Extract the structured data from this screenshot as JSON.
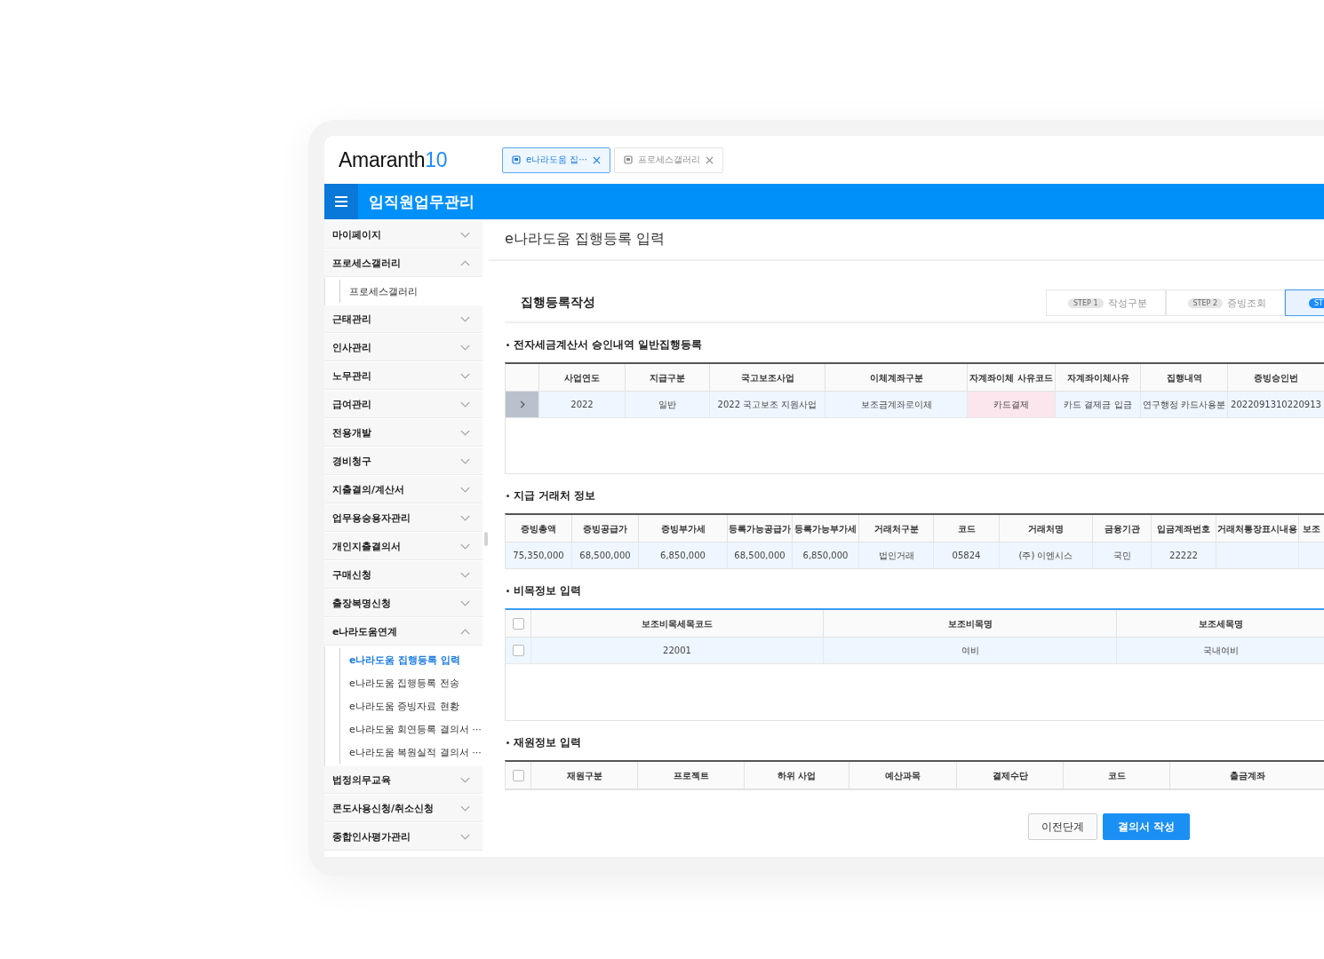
{
  "logo": {
    "name": "Amaranth",
    "version": "10"
  },
  "tabs": [
    {
      "label": "e나라도움 집···",
      "selected": true
    },
    {
      "label": "프로세스갤러리",
      "selected": false
    }
  ],
  "module_title": "임직원업무관리",
  "sidebar": {
    "items": [
      {
        "label": "마이페이지",
        "expanded": false
      },
      {
        "label": "프로세스갤러리",
        "expanded": true,
        "children": [
          {
            "label": "프로세스갤러리",
            "selected": false
          }
        ]
      },
      {
        "label": "근태관리",
        "expanded": false
      },
      {
        "label": "인사관리",
        "expanded": false
      },
      {
        "label": "노무관리",
        "expanded": false
      },
      {
        "label": "급여관리",
        "expanded": false
      },
      {
        "label": "전용개발",
        "expanded": false
      },
      {
        "label": "경비청구",
        "expanded": false
      },
      {
        "label": "지출결의/계산서",
        "expanded": false
      },
      {
        "label": "업무용승용자관리",
        "expanded": false
      },
      {
        "label": "개인지출결의서",
        "expanded": false
      },
      {
        "label": "구매신청",
        "expanded": false
      },
      {
        "label": "출장복명신청",
        "expanded": false
      },
      {
        "label": "e나라도움연계",
        "expanded": true,
        "children": [
          {
            "label": "e나라도움 집행등록 입력",
            "selected": true
          },
          {
            "label": "e나라도움 집행등록 전송",
            "selected": false
          },
          {
            "label": "e나라도움 증빙자료 현황",
            "selected": false
          },
          {
            "label": "e나라도움 회연등록 결의서 ···",
            "selected": false
          },
          {
            "label": "e나라도움 복원실적 결의서 ···",
            "selected": false
          }
        ]
      },
      {
        "label": "법정의무교육",
        "expanded": false
      },
      {
        "label": "콘도사용신청/취소신청",
        "expanded": false
      },
      {
        "label": "종합인사평가관리",
        "expanded": false
      }
    ]
  },
  "page_title": "e나라도움 집행등록 입력",
  "form_title": "집행등록작성",
  "steps": [
    {
      "badge": "STEP 1",
      "label": "작성구분",
      "selected": false
    },
    {
      "badge": "STEP 2",
      "label": "증빙조회",
      "selected": false
    },
    {
      "badge": "ST",
      "selected": true
    }
  ],
  "sections": [
    {
      "title": "전자세금계산서 승인내역 일반집행등록",
      "table": {
        "kind": "expand",
        "focused": false,
        "columns": [
          "사업연도",
          "지급구분",
          "국고보조사업",
          "이체계좌구분",
          "자계좌이체 사유코드",
          "자계좌이체사유",
          "집행내역",
          "증빙승인번"
        ],
        "rows": [
          {
            "selected": true,
            "cells": [
              {
                "text": "2022",
                "flagged": false
              },
              {
                "text": "일반",
                "flagged": false
              },
              {
                "text": "2022 국고보조 지원사업",
                "flagged": false
              },
              {
                "text": "보조금계좌로이체",
                "flagged": false
              },
              {
                "text": "카드결제",
                "flagged": true
              },
              {
                "text": "카드 결제금 입금",
                "flagged": false
              },
              {
                "text": "연구행정 카드사용분",
                "flagged": false
              },
              {
                "text": "2022091310220913",
                "flagged": false
              }
            ]
          }
        ]
      }
    },
    {
      "title": "지급 거래처 정보",
      "table": {
        "kind": "plain",
        "focused": false,
        "columns": [
          "증빙총액",
          "증빙공급가",
          "증빙부가세",
          "등록가능공급가",
          "등록가능부가세",
          "거래처구분",
          "코드",
          "거래처명",
          "금융기관",
          "입금계좌번호",
          "거래처통장표시내용",
          "보조"
        ],
        "rows": [
          {
            "selected": true,
            "cells": [
              "75,350,000",
              "68,500,000",
              "6,850,000",
              "68,500,000",
              "6,850,000",
              "법인거래",
              "05824",
              "(주) 이엔시스",
              "국민",
              "22222"
            ]
          }
        ]
      }
    },
    {
      "title": "비목정보 입력",
      "table": {
        "kind": "check",
        "focused": true,
        "header_checked": false,
        "columns": [
          "보조비목세목코드",
          "보조비목명",
          "보조세목명"
        ],
        "rows": [
          {
            "selected": true,
            "checked": false,
            "cells": [
              "22001",
              "여비",
              "국내여비"
            ]
          }
        ]
      }
    },
    {
      "title": "재원정보 입력",
      "table": {
        "kind": "check",
        "focused": false,
        "header_checked": false,
        "columns": [
          "재원구분",
          "프로젝트",
          "하위 사업",
          "예산과목",
          "결제수단",
          "코드",
          "출금계좌"
        ]
      }
    }
  ],
  "buttons": [
    {
      "label": "이전단계",
      "kind": "secondary"
    },
    {
      "label": "결의서 작성",
      "kind": "primary"
    }
  ]
}
